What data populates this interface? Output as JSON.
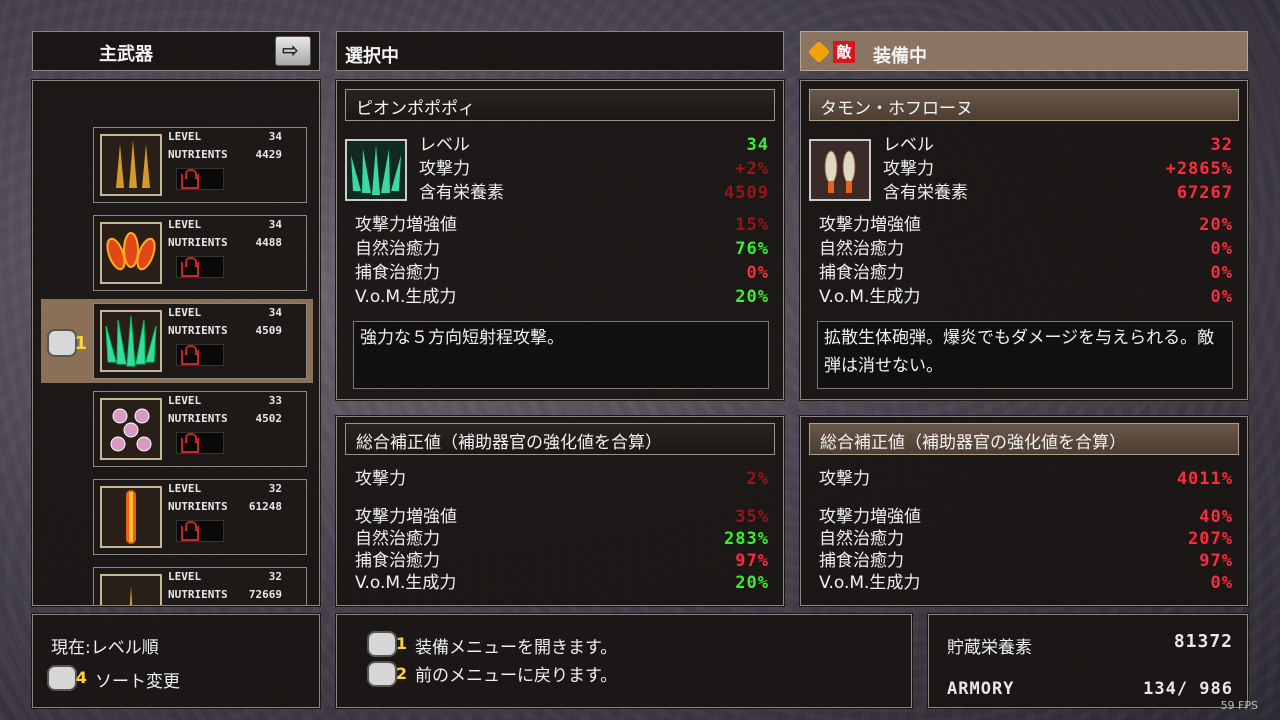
{
  "list": {
    "header": "主武器",
    "items": [
      {
        "level_key": "LEVEL",
        "level": "34",
        "nutr_key": "NUTRIENTS",
        "nutr": "4429"
      },
      {
        "level_key": "LEVEL",
        "level": "34",
        "nutr_key": "NUTRIENTS",
        "nutr": "4488"
      },
      {
        "level_key": "LEVEL",
        "level": "34",
        "nutr_key": "NUTRIENTS",
        "nutr": "4509"
      },
      {
        "level_key": "LEVEL",
        "level": "33",
        "nutr_key": "NUTRIENTS",
        "nutr": "4502"
      },
      {
        "level_key": "LEVEL",
        "level": "32",
        "nutr_key": "NUTRIENTS",
        "nutr": "61248"
      },
      {
        "level_key": "LEVEL",
        "level": "32",
        "nutr_key": "NUTRIENTS",
        "nutr": "72669"
      }
    ],
    "selected_index": 2
  },
  "selected": {
    "header": "選択中",
    "name": "ピオンポポポィ",
    "level_label": "レベル",
    "level": "34",
    "attack_label": "攻撃力",
    "attack": "+2%",
    "nutr_label": "含有栄養素",
    "nutr": "4509",
    "atk_boost_label": "攻撃力増強値",
    "atk_boost": "15%",
    "natural_label": "自然治癒力",
    "natural": "76%",
    "predation_label": "捕食治癒力",
    "predation": "0%",
    "vom_label": "V.o.M.生成力",
    "vom": "20%",
    "description": "強力な５方向短射程攻撃。"
  },
  "selected_total": {
    "header": "総合補正値（補助器官の強化値を合算）",
    "attack_label": "攻撃力",
    "attack": "2%",
    "atk_boost_label": "攻撃力増強値",
    "atk_boost": "35%",
    "natural_label": "自然治癒力",
    "natural": "283%",
    "predation_label": "捕食治癒力",
    "predation": "97%",
    "vom_label": "V.o.M.生成力",
    "vom": "20%"
  },
  "equipped": {
    "badge": "敵",
    "header": "装備中",
    "name": "タモン・ホフローヌ",
    "level_label": "レベル",
    "level": "32",
    "attack_label": "攻撃力",
    "attack": "+2865%",
    "nutr_label": "含有栄養素",
    "nutr": "67267",
    "atk_boost_label": "攻撃力増強値",
    "atk_boost": "20%",
    "natural_label": "自然治癒力",
    "natural": "0%",
    "predation_label": "捕食治癒力",
    "predation": "0%",
    "vom_label": "V.o.M.生成力",
    "vom": "0%",
    "description": "拡散生体砲弾。爆炎でもダメージを与えられる。敵弾は消せない。"
  },
  "equipped_total": {
    "header": "総合補正値（補助器官の強化値を合算）",
    "attack_label": "攻撃力",
    "attack": "4011%",
    "atk_boost_label": "攻撃力増強値",
    "atk_boost": "40%",
    "natural_label": "自然治癒力",
    "natural": "207%",
    "predation_label": "捕食治癒力",
    "predation": "97%",
    "vom_label": "V.o.M.生成力",
    "vom": "0%"
  },
  "sort": {
    "current": "現在:レベル順",
    "button_num": "4",
    "action": "ソート変更"
  },
  "help": {
    "line1_num": "1",
    "line1": "装備メニューを開きます。",
    "line2_num": "2",
    "line2": "前のメニューに戻ります。"
  },
  "stock": {
    "label": "貯蔵栄養素",
    "value": "81372",
    "armory_label": "ARMORY",
    "armory": "134/ 986"
  },
  "fps": "59 FPS",
  "colors": {
    "green": "#38f02f",
    "red": "#ff2a3c",
    "darkred": "#9a1418",
    "select": "#8a7057"
  }
}
